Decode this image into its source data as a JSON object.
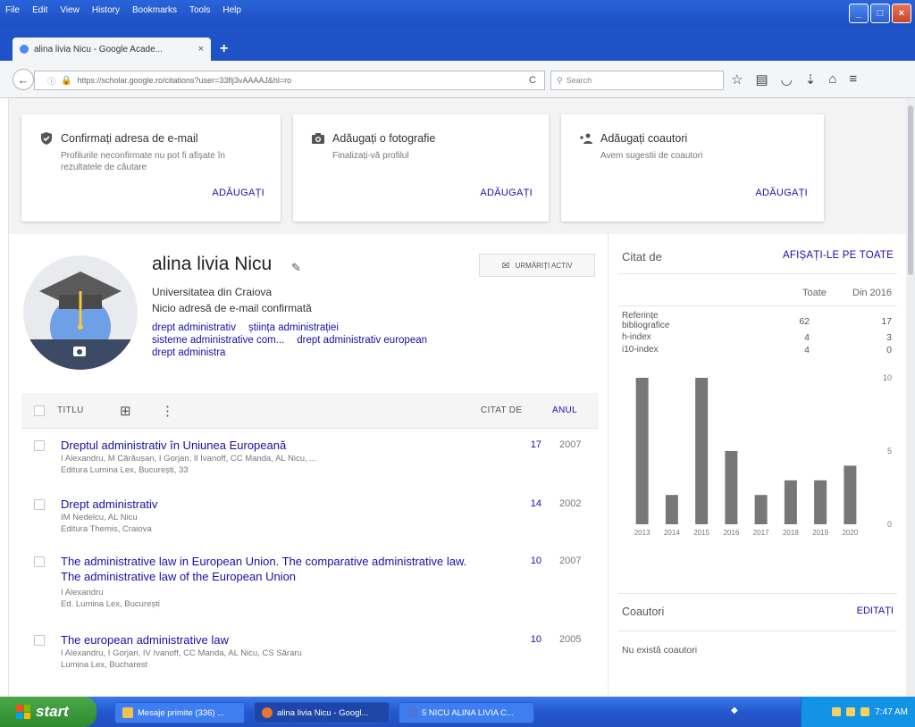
{
  "browser": {
    "menu": [
      "File",
      "Edit",
      "View",
      "History",
      "Bookmarks",
      "Tools",
      "Help"
    ],
    "tab_label": "alina livia Nicu - Google Acade...",
    "tab_close": "×",
    "new_tab": "+",
    "url": "https://scholar.google.ro/citations?user=33flj3vAAAAJ&hl=ro",
    "search_placeholder": "Search"
  },
  "cards": [
    {
      "title": "Confirmați adresa de e-mail",
      "desc": "Profilurile neconfirmate nu pot fi afișate în rezultatele de căutare",
      "action": "ADĂUGAȚI",
      "icon": "shield-check-icon"
    },
    {
      "title": "Adăugați o fotografie",
      "desc": "Finalizați-vă profilul",
      "action": "ADĂUGAȚI",
      "icon": "camera-icon"
    },
    {
      "title": "Adăugați coautori",
      "desc": "Avem sugestii de coautori",
      "action": "ADĂUGAȚI",
      "icon": "add-people-icon"
    }
  ],
  "profile": {
    "name": "alina livia Nicu",
    "affiliation": "Universitatea din Craiova",
    "email": "Nicio adresă de e-mail confirmată",
    "follow": "URMĂRIȚI ACTIV",
    "interests": [
      "drept administrativ",
      "știința administrației",
      "sisteme administrative com...",
      "drept administrativ european",
      "drept administra"
    ]
  },
  "table": {
    "col_title": "TITLU",
    "col_cited": "CITAT DE",
    "col_year": "ANUL",
    "rows": [
      {
        "title": "Dreptul administrativ în Uniunea Europeană",
        "authors": "I Alexandru, M Cărăușan, I Gorjan, Il Ivanoff, CC Manda, AL Nicu, ...",
        "venue": "Editura Lumina Lex, București, 33",
        "cited": "17",
        "year": "2007"
      },
      {
        "title": "Drept administrativ",
        "authors": "IM Nedelcu, AL Nicu",
        "venue": "Editura Themis, Craiova",
        "cited": "14",
        "year": "2002"
      },
      {
        "title": "The administrative law in European Union. The comparative administrative law. The administrative law of the European Union",
        "authors": "I Alexandru",
        "venue": "Ed. Lumina Lex, București",
        "cited": "10",
        "year": "2007"
      },
      {
        "title": "The european administrative law",
        "authors": "I Alexandru, I Gorjan, IV Ivanoff, CC Manda, AL Nicu, CS Săraru",
        "venue": "Lumina Lex, Bucharest",
        "cited": "10",
        "year": "2005"
      }
    ]
  },
  "cited_by": {
    "heading": "Citat de",
    "view_all": "AFIȘAȚI-LE PE TOATE",
    "col_all": "Toate",
    "col_since": "Din 2016",
    "rows": [
      {
        "label": "Referințe bibliografice",
        "all": "62",
        "since": "17"
      },
      {
        "label": "h-index",
        "all": "4",
        "since": "3"
      },
      {
        "label": "i10-index",
        "all": "4",
        "since": "0"
      }
    ]
  },
  "chart_data": {
    "type": "bar",
    "categories": [
      "2013",
      "2014",
      "2015",
      "2016",
      "2017",
      "2018",
      "2019",
      "2020"
    ],
    "values": [
      10,
      2,
      10,
      5,
      2,
      3,
      3,
      4
    ],
    "ylim": [
      0,
      10
    ],
    "yticks": [
      "10",
      "5",
      "0"
    ],
    "color": "#777777"
  },
  "coauthors": {
    "heading": "Coautori",
    "edit": "EDITAȚI",
    "none": "Nu există coautori"
  },
  "taskbar": {
    "start": "start",
    "items": [
      "Mesaje primite (336) ...",
      "alina livia Nicu - Googl...",
      "5 NICU ALINA LIVIA C..."
    ],
    "clock": "7:47 AM"
  }
}
